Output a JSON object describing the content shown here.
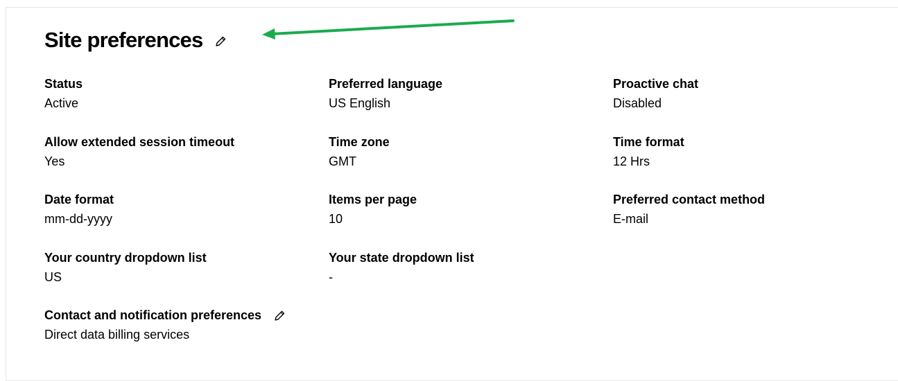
{
  "title": "Site preferences",
  "colors": {
    "annotation_arrow": "#1aab4f",
    "card_border": "#e6e6e6"
  },
  "icons": {
    "title_edit": "pencil-icon",
    "contact_edit": "pencil-icon"
  },
  "fields": {
    "status": {
      "label": "Status",
      "value": "Active"
    },
    "preferred_language": {
      "label": "Preferred language",
      "value": "US English"
    },
    "proactive_chat": {
      "label": "Proactive chat",
      "value": "Disabled"
    },
    "extended_session": {
      "label": "Allow extended session timeout",
      "value": "Yes"
    },
    "time_zone": {
      "label": "Time zone",
      "value": "GMT"
    },
    "time_format": {
      "label": "Time format",
      "value": "12 Hrs"
    },
    "date_format": {
      "label": "Date format",
      "value": "mm-dd-yyyy"
    },
    "items_per_page": {
      "label": "Items per page",
      "value": "10"
    },
    "contact_method": {
      "label": "Preferred contact method",
      "value": "E-mail"
    },
    "country_dropdown": {
      "label": "Your country dropdown list",
      "value": "US"
    },
    "state_dropdown": {
      "label": "Your state dropdown list",
      "value": "-"
    },
    "contact_notifications": {
      "label": "Contact and notification preferences",
      "value": "Direct data billing services"
    }
  }
}
